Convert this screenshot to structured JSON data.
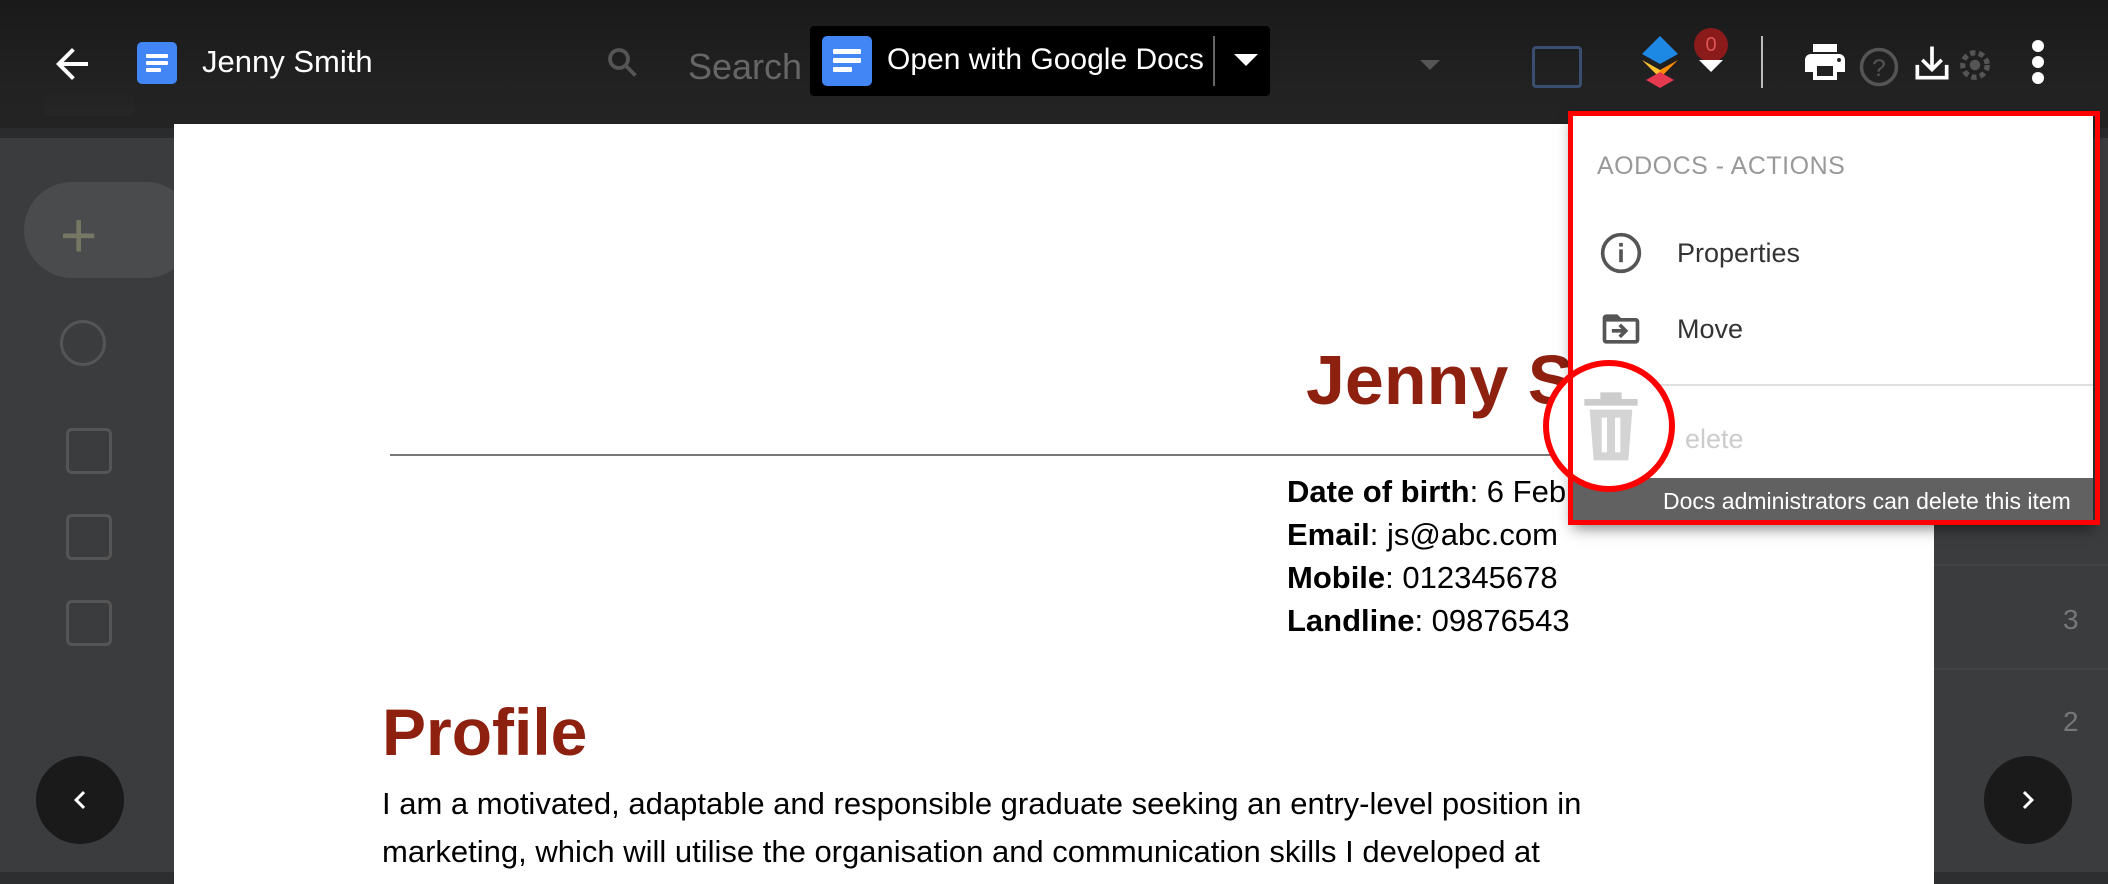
{
  "viewer": {
    "file_title": "Jenny Smith",
    "open_with_label": "Open with Google Docs",
    "badge_count": "0",
    "bg_search_text": "Search"
  },
  "document": {
    "name": "Jenny S",
    "contact": [
      {
        "label": "Date of birth",
        "value": ": 6 Feb"
      },
      {
        "label": "Email",
        "value": ": js@abc.com"
      },
      {
        "label": "Mobile",
        "value": ": 012345678"
      },
      {
        "label": "Landline",
        "value": ": 09876543"
      }
    ],
    "profile_heading": "Profile",
    "profile_lines": [
      "I am a motivated, adaptable and responsible graduate seeking an entry-level position in",
      "marketing, which will utilise the organisation and communication skills I developed at"
    ]
  },
  "menu": {
    "header": "AODOCS - ACTIONS",
    "items": [
      {
        "label": "Properties",
        "icon": "info-icon"
      },
      {
        "label": "Move",
        "icon": "move-folder-icon"
      },
      {
        "label": "elete",
        "icon": "trash-icon"
      }
    ],
    "tooltip": "Docs administrators can delete this item"
  },
  "background_list_numbers": [
    "3",
    "2"
  ],
  "colors": {
    "accent_red": "#8e2010",
    "highlight": "#ff0000",
    "docs_blue": "#4285f4"
  }
}
